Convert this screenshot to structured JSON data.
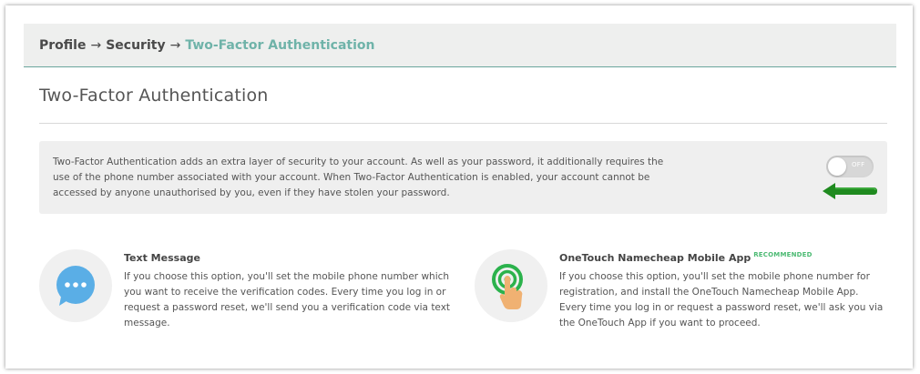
{
  "breadcrumb": {
    "items": [
      "Profile",
      "Security",
      "Two-Factor Authentication"
    ],
    "separator": "→"
  },
  "page": {
    "title": "Two-Factor Authentication"
  },
  "info": {
    "text": "Two-Factor Authentication adds an extra layer of security to your account. As well as your password, it additionally requires the use of the phone number associated with your account. When Two-Factor Authentication is enabled, your account cannot be accessed by anyone unauthorised by you, even if they have stolen your password.",
    "toggle_label": "OFF",
    "toggle_state": "off"
  },
  "options": [
    {
      "icon": "chat-bubble-icon",
      "heading": "Text Message",
      "badge": "",
      "description": "If you choose this option, you'll set the mobile phone number which you want to receive the verification codes. Every time you log in or request a password reset, we'll send you a verification code via text message."
    },
    {
      "icon": "touch-finger-icon",
      "heading": "OneTouch Namecheap Mobile App",
      "badge": "RECOMMENDED",
      "description": "If you choose this option, you'll set the mobile phone number for registration, and install the OneTouch Namecheap Mobile App. Every time you log in or request a password reset, we'll ask you via the OneTouch App if you want to proceed."
    }
  ],
  "colors": {
    "accent": "#6fb3a9",
    "badge_green": "#4cba73",
    "arrow_green": "#1f8a1f",
    "chat_blue": "#5aaee6",
    "touch_green": "#2bb24c",
    "finger": "#f0b172"
  }
}
